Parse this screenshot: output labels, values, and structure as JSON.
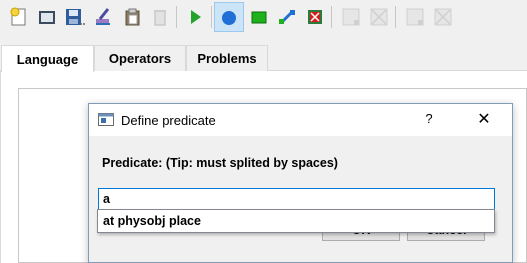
{
  "toolbar": {
    "buttons": [
      {
        "icon": "new-icon",
        "enabled": true
      },
      {
        "icon": "open-icon",
        "enabled": true
      },
      {
        "icon": "save-icon",
        "enabled": true
      },
      {
        "icon": "clean-icon",
        "enabled": true
      },
      {
        "icon": "paste-icon",
        "enabled": true
      },
      {
        "icon": "trash-icon",
        "enabled": false
      },
      {
        "icon": "run-icon",
        "enabled": true
      },
      {
        "icon": "circle-tool-icon",
        "enabled": true,
        "active": true
      },
      {
        "icon": "rectangle-tool-icon",
        "enabled": true
      },
      {
        "icon": "connect-tool-icon",
        "enabled": true
      },
      {
        "icon": "delete-node-icon",
        "enabled": true
      },
      {
        "icon": "disabled-tool-1-icon",
        "enabled": false
      },
      {
        "icon": "disabled-tool-2-icon",
        "enabled": false
      },
      {
        "icon": "disabled-tool-3-icon",
        "enabled": false
      },
      {
        "icon": "disabled-tool-4-icon",
        "enabled": false
      }
    ],
    "colors": {
      "active_bg": "#cce4f7",
      "green": "#22a32a",
      "blue": "#1f6fd6",
      "red": "#d21f1f"
    }
  },
  "tabs": [
    {
      "label": "Language",
      "active": true
    },
    {
      "label": "Operators",
      "active": false
    },
    {
      "label": "Problems",
      "active": false
    }
  ],
  "dialog": {
    "title": "Define predicate",
    "help": "?",
    "close": "✕",
    "label": "Predicate: (Tip: must splited by spaces)",
    "input_value": "a",
    "ok_label": "OK",
    "cancel_label": "Cancel"
  },
  "completer": {
    "items": [
      "at physobj place"
    ]
  }
}
